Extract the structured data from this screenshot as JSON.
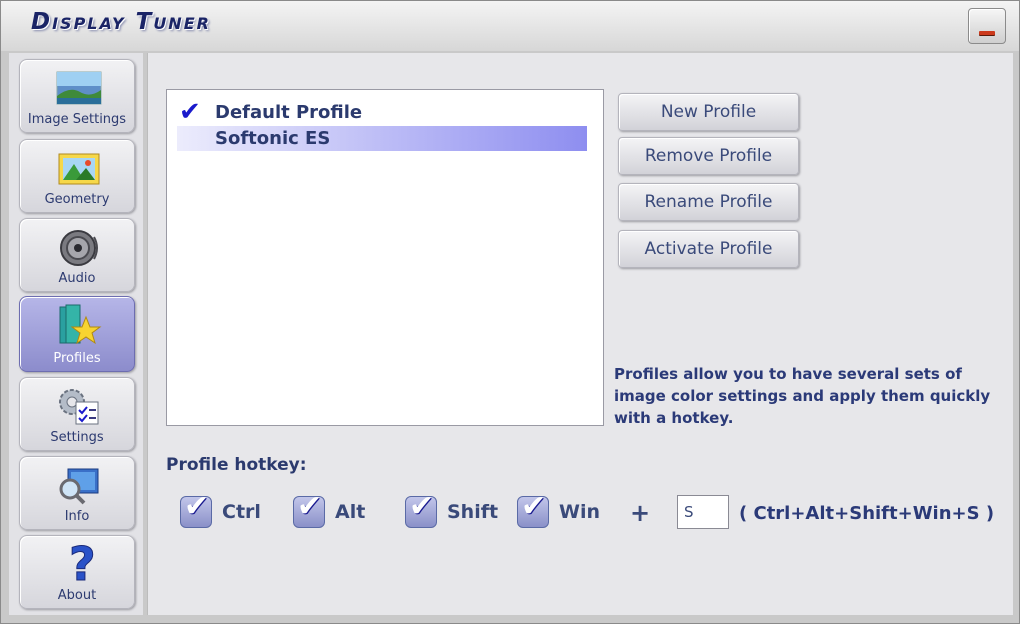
{
  "window": {
    "title": "Display Tuner"
  },
  "sidebar": {
    "items": [
      {
        "label": "Image Settings",
        "icon": "image-settings-icon"
      },
      {
        "label": "Geometry",
        "icon": "geometry-icon"
      },
      {
        "label": "Audio",
        "icon": "speaker-icon"
      },
      {
        "label": "Profiles",
        "icon": "profiles-star-icon",
        "active": true
      },
      {
        "label": "Settings",
        "icon": "settings-gear-icon"
      },
      {
        "label": "Info",
        "icon": "info-magnifier-icon"
      },
      {
        "label": "About",
        "icon": "question-mark-icon"
      }
    ]
  },
  "profiles": {
    "items": [
      {
        "name": "Default Profile",
        "active": true
      },
      {
        "name": "Softonic ES",
        "selected": true
      }
    ]
  },
  "buttons": {
    "new_profile": "New Profile",
    "remove_profile": "Remove Profile",
    "rename_profile": "Rename Profile",
    "activate_profile": "Activate Profile"
  },
  "description": "Profiles allow you to have several sets of image color settings and apply them quickly with a hotkey.",
  "hotkey": {
    "label": "Profile hotkey:",
    "modifiers": [
      {
        "label": "Ctrl",
        "checked": true
      },
      {
        "label": "Alt",
        "checked": true
      },
      {
        "label": "Shift",
        "checked": true
      },
      {
        "label": "Win",
        "checked": true
      }
    ],
    "plus": "+",
    "key_value": "S",
    "combination": "( Ctrl+Alt+Shift+Win+S )"
  },
  "colors": {
    "accent": "#2b3a78",
    "selection": "#8e8ef0",
    "active_tab": "#9c9cdc"
  }
}
